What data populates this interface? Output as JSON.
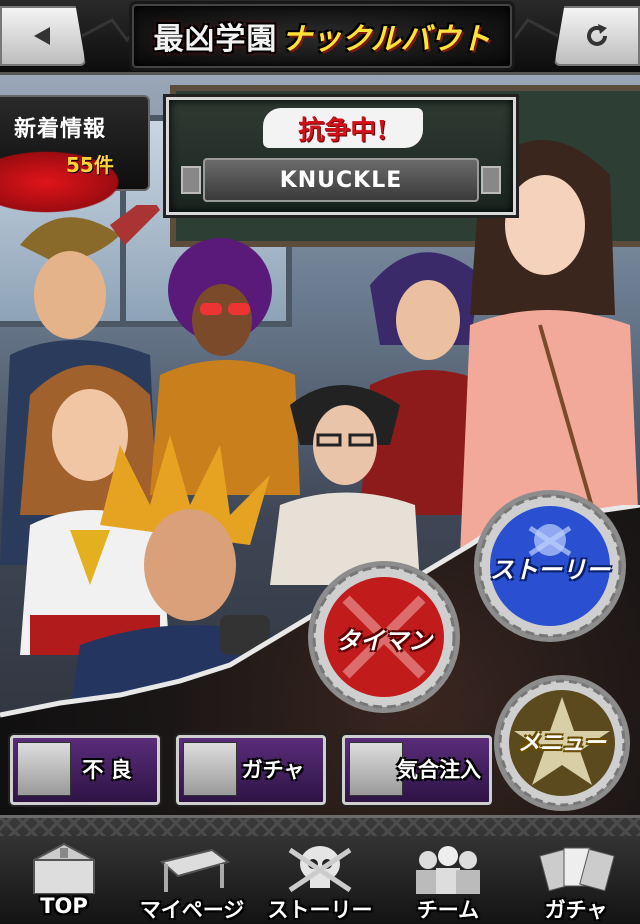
{
  "header": {
    "title_part1": "最凶学園",
    "title_part2": "ナックルバウト",
    "back_icon": "triangle-left-icon",
    "refresh_icon": "refresh-icon"
  },
  "news": {
    "label": "新着情報",
    "count": "55件"
  },
  "status": {
    "label": "抗争中!",
    "value": "KNUCKLE"
  },
  "caps": {
    "story": "ストーリー",
    "taiman": "タイマン",
    "menu": "メニュー"
  },
  "buttons": {
    "furyo": "不 良",
    "gacha": "ガチャ",
    "kiai": "気合注入"
  },
  "nav": [
    {
      "label": "TOP",
      "icon": "school-building-icon"
    },
    {
      "label": "マイページ",
      "icon": "desk-icon"
    },
    {
      "label": "ストーリー",
      "icon": "skull-icon"
    },
    {
      "label": "チーム",
      "icon": "team-icon"
    },
    {
      "label": "ガチャ",
      "icon": "cards-icon"
    }
  ],
  "colors": {
    "accent_red": "#d0111a",
    "cap_blue": "#2a4fd0",
    "cap_red": "#c21b1b",
    "cap_gold": "#c9a227",
    "button_purple": "#5a2c7a"
  }
}
